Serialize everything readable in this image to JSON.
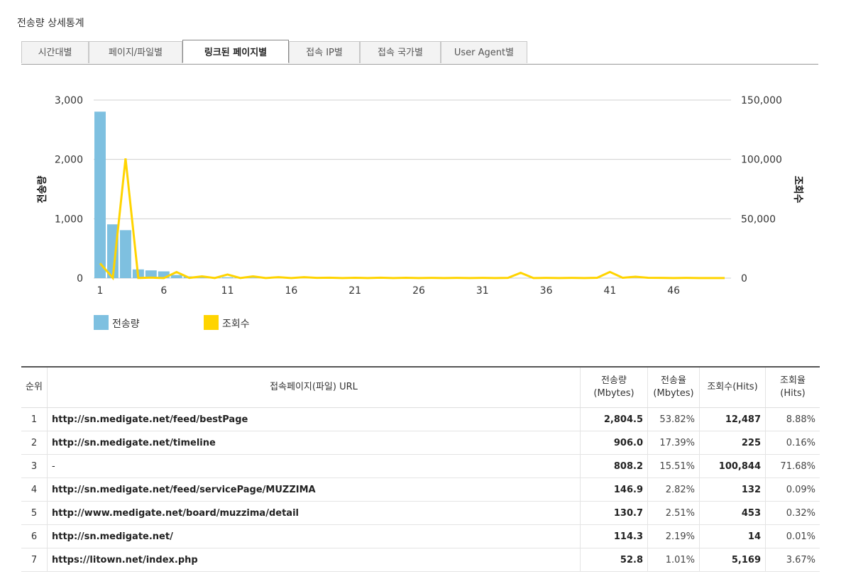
{
  "page_title": "전송량 상세통계",
  "tabs": [
    {
      "label": "시간대별",
      "active": false
    },
    {
      "label": "페이지/파일별",
      "active": false
    },
    {
      "label": "링크된 페이지별",
      "active": true
    },
    {
      "label": "접속 IP별",
      "active": false
    },
    {
      "label": "접속 국가별",
      "active": false
    },
    {
      "label": "User Agent별",
      "active": false
    }
  ],
  "chart_data": {
    "type": "bar",
    "title": "",
    "ylabel_left": "전송량",
    "ylabel_right": "조회수",
    "ylim_left": [
      0,
      3000
    ],
    "ylim_right": [
      0,
      150000
    ],
    "yticks_left": [
      "0",
      "1,000",
      "2,000",
      "3,000"
    ],
    "yticks_right": [
      "0",
      "50,000",
      "100,000",
      "150,000"
    ],
    "xticks": [
      "1",
      "6",
      "11",
      "16",
      "21",
      "26",
      "31",
      "36",
      "41",
      "46"
    ],
    "x": [
      1,
      2,
      3,
      4,
      5,
      6,
      7,
      8,
      9,
      10,
      11,
      12,
      13,
      14,
      15,
      16,
      17,
      18,
      19,
      20,
      21,
      22,
      23,
      24,
      25,
      26,
      27,
      28,
      29,
      30,
      31,
      32,
      33,
      34,
      35,
      36,
      37,
      38,
      39,
      40,
      41,
      42,
      43,
      44,
      45,
      46,
      47,
      48,
      49,
      50
    ],
    "legend_position": "bottom-left",
    "grid": true,
    "series": [
      {
        "name": "전송량",
        "axis": "left",
        "kind": "bar",
        "color": "#7ec0e0",
        "values": [
          2804.5,
          906.0,
          808.2,
          146.9,
          130.7,
          114.3,
          52.8,
          30,
          25,
          20,
          15,
          12,
          10,
          9,
          8,
          7,
          6,
          5,
          5,
          4,
          4,
          3,
          3,
          3,
          3,
          2,
          2,
          2,
          2,
          2,
          2,
          2,
          2,
          2,
          2,
          1,
          1,
          1,
          1,
          1,
          1,
          1,
          1,
          1,
          1,
          1,
          1,
          1,
          1,
          1
        ]
      },
      {
        "name": "조회수",
        "axis": "right",
        "kind": "line",
        "color": "#ffd400",
        "values": [
          12487,
          225,
          100844,
          132,
          453,
          14,
          5169,
          200,
          1500,
          100,
          3000,
          100,
          1500,
          100,
          800,
          100,
          800,
          200,
          400,
          100,
          300,
          100,
          400,
          100,
          300,
          100,
          200,
          100,
          200,
          100,
          200,
          100,
          200,
          4500,
          100,
          200,
          100,
          200,
          100,
          300,
          5200,
          300,
          1200,
          300,
          200,
          100,
          200,
          100,
          100,
          100
        ]
      }
    ]
  },
  "table": {
    "headers": {
      "rank": "순위",
      "url": "접속페이지(파일) URL",
      "transfer_line1": "전송량",
      "transfer_line2": "(Mbytes)",
      "transfer_rate_line1": "전송율",
      "transfer_rate_line2": "(Mbytes)",
      "hits": "조회수(Hits)",
      "hit_rate_line1": "조회율",
      "hit_rate_line2": "(Hits)"
    },
    "rows": [
      {
        "rank": "1",
        "url": "http://sn.medigate.net/feed/bestPage",
        "transfer": "2,804.5",
        "transfer_rate": "53.82%",
        "hits": "12,487",
        "hit_rate": "8.88%"
      },
      {
        "rank": "2",
        "url": "http://sn.medigate.net/timeline",
        "transfer": "906.0",
        "transfer_rate": "17.39%",
        "hits": "225",
        "hit_rate": "0.16%"
      },
      {
        "rank": "3",
        "url": "-",
        "transfer": "808.2",
        "transfer_rate": "15.51%",
        "hits": "100,844",
        "hit_rate": "71.68%"
      },
      {
        "rank": "4",
        "url": "http://sn.medigate.net/feed/servicePage/MUZZIMA",
        "transfer": "146.9",
        "transfer_rate": "2.82%",
        "hits": "132",
        "hit_rate": "0.09%"
      },
      {
        "rank": "5",
        "url": "http://www.medigate.net/board/muzzima/detail",
        "transfer": "130.7",
        "transfer_rate": "2.51%",
        "hits": "453",
        "hit_rate": "0.32%"
      },
      {
        "rank": "6",
        "url": "http://sn.medigate.net/",
        "transfer": "114.3",
        "transfer_rate": "2.19%",
        "hits": "14",
        "hit_rate": "0.01%"
      },
      {
        "rank": "7",
        "url": "https://litown.net/index.php",
        "transfer": "52.8",
        "transfer_rate": "1.01%",
        "hits": "5,169",
        "hit_rate": "3.67%"
      }
    ]
  }
}
